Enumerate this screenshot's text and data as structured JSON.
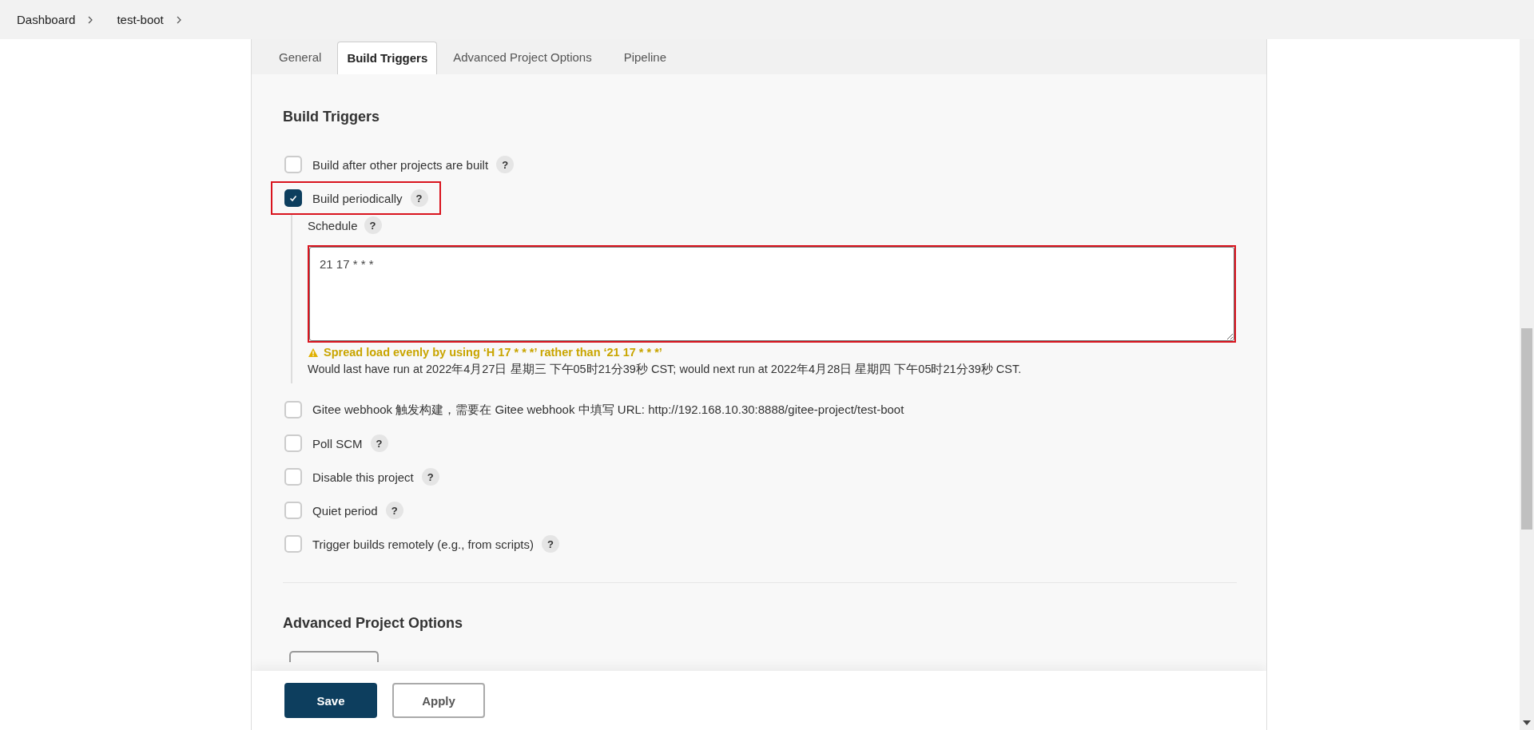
{
  "breadcrumbs": [
    {
      "label": "Dashboard"
    },
    {
      "label": "test-boot"
    }
  ],
  "tabs": [
    {
      "label": "General",
      "selected": false
    },
    {
      "label": "Build Triggers",
      "selected": true
    },
    {
      "label": "Advanced Project Options",
      "selected": false
    },
    {
      "label": "Pipeline",
      "selected": false
    }
  ],
  "build_triggers": {
    "title": "Build Triggers",
    "items": [
      {
        "label": "Build after other projects are built",
        "checked": false,
        "help": true,
        "highlighted": false
      },
      {
        "label": "Build periodically",
        "checked": true,
        "help": true,
        "highlighted": true,
        "schedule": {
          "label": "Schedule",
          "help": true,
          "value": "21 17 * * *",
          "highlighted": true,
          "warning": "Spread load evenly by using ‘H 17 * * *’ rather than ‘21 17 * * *’",
          "info": "Would last have run at 2022年4月27日 星期三 下午05时21分39秒 CST; would next run at 2022年4月28日 星期四 下午05时21分39秒 CST."
        }
      },
      {
        "label": "Gitee webhook 触发构建，需要在 Gitee webhook 中填写 URL: http://192.168.10.30:8888/gitee-project/test-boot",
        "checked": false,
        "help": false,
        "highlighted": false
      },
      {
        "label": "Poll SCM",
        "checked": false,
        "help": true,
        "highlighted": false
      },
      {
        "label": "Disable this project",
        "checked": false,
        "help": true,
        "highlighted": false
      },
      {
        "label": "Quiet period",
        "checked": false,
        "help": true,
        "highlighted": false
      },
      {
        "label": "Trigger builds remotely (e.g., from scripts)",
        "checked": false,
        "help": true,
        "highlighted": false
      }
    ]
  },
  "advanced_project_options": {
    "title": "Advanced Project Options"
  },
  "help_mark": "?",
  "buttons": [
    {
      "label": "Save",
      "kind": "primary"
    },
    {
      "label": "Apply",
      "kind": "secondary"
    }
  ]
}
